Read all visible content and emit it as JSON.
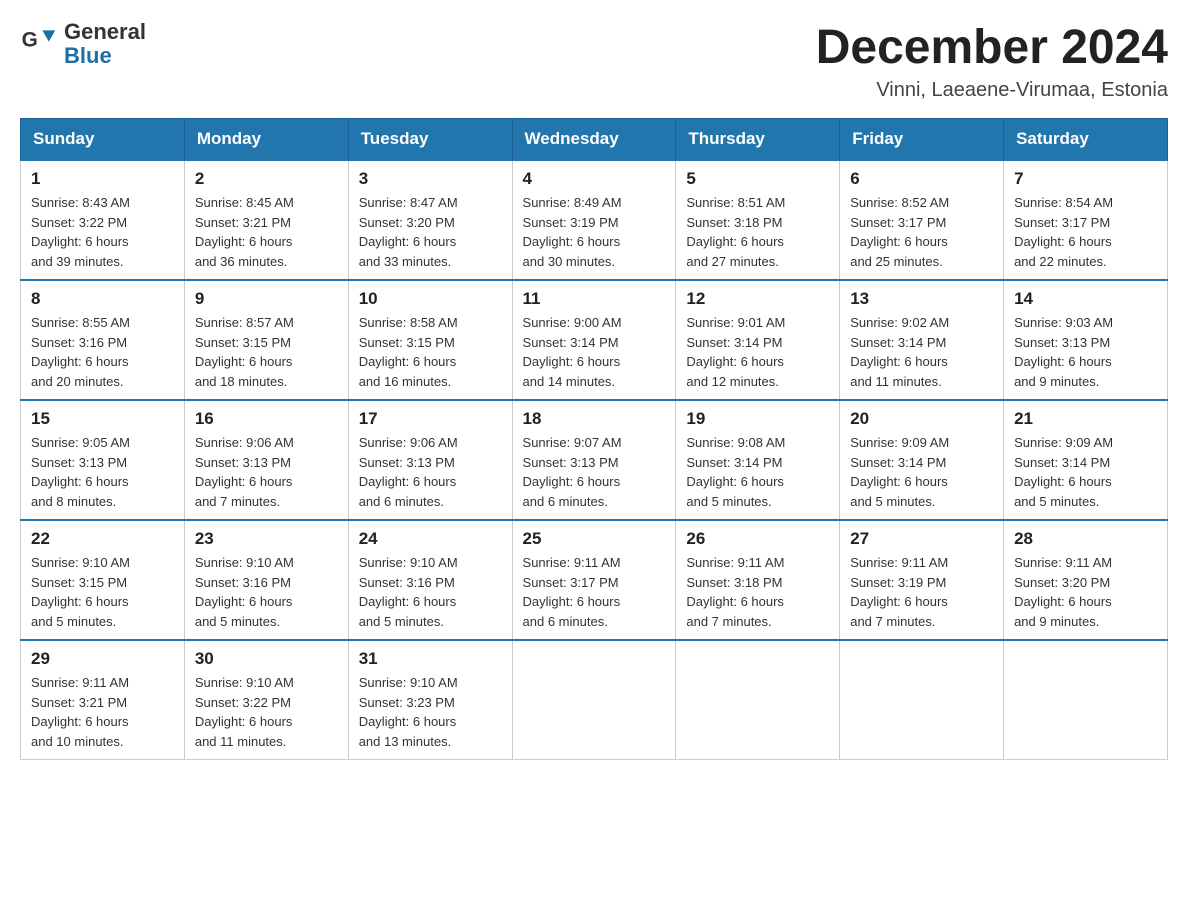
{
  "header": {
    "logo_general": "General",
    "logo_blue": "Blue",
    "main_title": "December 2024",
    "subtitle": "Vinni, Laeaene-Virumaa, Estonia"
  },
  "weekdays": [
    "Sunday",
    "Monday",
    "Tuesday",
    "Wednesday",
    "Thursday",
    "Friday",
    "Saturday"
  ],
  "weeks": [
    [
      {
        "day": "1",
        "info": "Sunrise: 8:43 AM\nSunset: 3:22 PM\nDaylight: 6 hours\nand 39 minutes."
      },
      {
        "day": "2",
        "info": "Sunrise: 8:45 AM\nSunset: 3:21 PM\nDaylight: 6 hours\nand 36 minutes."
      },
      {
        "day": "3",
        "info": "Sunrise: 8:47 AM\nSunset: 3:20 PM\nDaylight: 6 hours\nand 33 minutes."
      },
      {
        "day": "4",
        "info": "Sunrise: 8:49 AM\nSunset: 3:19 PM\nDaylight: 6 hours\nand 30 minutes."
      },
      {
        "day": "5",
        "info": "Sunrise: 8:51 AM\nSunset: 3:18 PM\nDaylight: 6 hours\nand 27 minutes."
      },
      {
        "day": "6",
        "info": "Sunrise: 8:52 AM\nSunset: 3:17 PM\nDaylight: 6 hours\nand 25 minutes."
      },
      {
        "day": "7",
        "info": "Sunrise: 8:54 AM\nSunset: 3:17 PM\nDaylight: 6 hours\nand 22 minutes."
      }
    ],
    [
      {
        "day": "8",
        "info": "Sunrise: 8:55 AM\nSunset: 3:16 PM\nDaylight: 6 hours\nand 20 minutes."
      },
      {
        "day": "9",
        "info": "Sunrise: 8:57 AM\nSunset: 3:15 PM\nDaylight: 6 hours\nand 18 minutes."
      },
      {
        "day": "10",
        "info": "Sunrise: 8:58 AM\nSunset: 3:15 PM\nDaylight: 6 hours\nand 16 minutes."
      },
      {
        "day": "11",
        "info": "Sunrise: 9:00 AM\nSunset: 3:14 PM\nDaylight: 6 hours\nand 14 minutes."
      },
      {
        "day": "12",
        "info": "Sunrise: 9:01 AM\nSunset: 3:14 PM\nDaylight: 6 hours\nand 12 minutes."
      },
      {
        "day": "13",
        "info": "Sunrise: 9:02 AM\nSunset: 3:14 PM\nDaylight: 6 hours\nand 11 minutes."
      },
      {
        "day": "14",
        "info": "Sunrise: 9:03 AM\nSunset: 3:13 PM\nDaylight: 6 hours\nand 9 minutes."
      }
    ],
    [
      {
        "day": "15",
        "info": "Sunrise: 9:05 AM\nSunset: 3:13 PM\nDaylight: 6 hours\nand 8 minutes."
      },
      {
        "day": "16",
        "info": "Sunrise: 9:06 AM\nSunset: 3:13 PM\nDaylight: 6 hours\nand 7 minutes."
      },
      {
        "day": "17",
        "info": "Sunrise: 9:06 AM\nSunset: 3:13 PM\nDaylight: 6 hours\nand 6 minutes."
      },
      {
        "day": "18",
        "info": "Sunrise: 9:07 AM\nSunset: 3:13 PM\nDaylight: 6 hours\nand 6 minutes."
      },
      {
        "day": "19",
        "info": "Sunrise: 9:08 AM\nSunset: 3:14 PM\nDaylight: 6 hours\nand 5 minutes."
      },
      {
        "day": "20",
        "info": "Sunrise: 9:09 AM\nSunset: 3:14 PM\nDaylight: 6 hours\nand 5 minutes."
      },
      {
        "day": "21",
        "info": "Sunrise: 9:09 AM\nSunset: 3:14 PM\nDaylight: 6 hours\nand 5 minutes."
      }
    ],
    [
      {
        "day": "22",
        "info": "Sunrise: 9:10 AM\nSunset: 3:15 PM\nDaylight: 6 hours\nand 5 minutes."
      },
      {
        "day": "23",
        "info": "Sunrise: 9:10 AM\nSunset: 3:16 PM\nDaylight: 6 hours\nand 5 minutes."
      },
      {
        "day": "24",
        "info": "Sunrise: 9:10 AM\nSunset: 3:16 PM\nDaylight: 6 hours\nand 5 minutes."
      },
      {
        "day": "25",
        "info": "Sunrise: 9:11 AM\nSunset: 3:17 PM\nDaylight: 6 hours\nand 6 minutes."
      },
      {
        "day": "26",
        "info": "Sunrise: 9:11 AM\nSunset: 3:18 PM\nDaylight: 6 hours\nand 7 minutes."
      },
      {
        "day": "27",
        "info": "Sunrise: 9:11 AM\nSunset: 3:19 PM\nDaylight: 6 hours\nand 7 minutes."
      },
      {
        "day": "28",
        "info": "Sunrise: 9:11 AM\nSunset: 3:20 PM\nDaylight: 6 hours\nand 9 minutes."
      }
    ],
    [
      {
        "day": "29",
        "info": "Sunrise: 9:11 AM\nSunset: 3:21 PM\nDaylight: 6 hours\nand 10 minutes."
      },
      {
        "day": "30",
        "info": "Sunrise: 9:10 AM\nSunset: 3:22 PM\nDaylight: 6 hours\nand 11 minutes."
      },
      {
        "day": "31",
        "info": "Sunrise: 9:10 AM\nSunset: 3:23 PM\nDaylight: 6 hours\nand 13 minutes."
      },
      {
        "day": "",
        "info": ""
      },
      {
        "day": "",
        "info": ""
      },
      {
        "day": "",
        "info": ""
      },
      {
        "day": "",
        "info": ""
      }
    ]
  ]
}
